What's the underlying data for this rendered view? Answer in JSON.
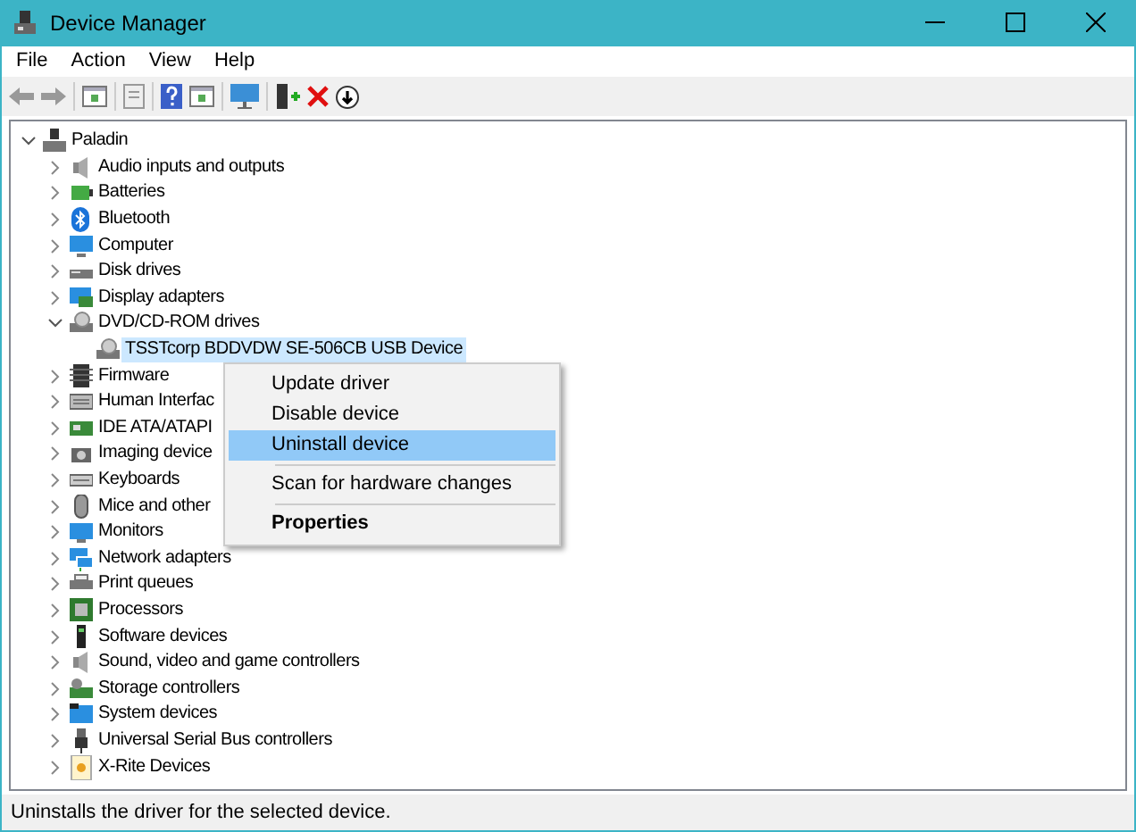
{
  "window": {
    "title": "Device Manager"
  },
  "menu_bar": [
    "File",
    "Action",
    "View",
    "Help"
  ],
  "tree": [
    {
      "label": "Paladin",
      "expanded": true,
      "selected": false,
      "children": [
        {
          "label": "Audio inputs and outputs",
          "expanded": false,
          "selected": false
        },
        {
          "label": "Batteries",
          "expanded": false,
          "selected": false
        },
        {
          "label": "Bluetooth",
          "expanded": false,
          "selected": false
        },
        {
          "label": "Computer",
          "expanded": false,
          "selected": false
        },
        {
          "label": "Disk drives",
          "expanded": false,
          "selected": false
        },
        {
          "label": "Display adapters",
          "expanded": false,
          "selected": false
        },
        {
          "label": "DVD/CD-ROM drives",
          "expanded": true,
          "selected": false,
          "children": [
            {
              "label": "TSSTcorp BDDVDW SE-506CB USB Device",
              "selected": true
            }
          ]
        },
        {
          "label": "Firmware",
          "expanded": false,
          "selected": false
        },
        {
          "label": "Human Interfac",
          "expanded": false,
          "selected": false
        },
        {
          "label": "IDE ATA/ATAPI",
          "expanded": false,
          "selected": false
        },
        {
          "label": "Imaging device",
          "expanded": false,
          "selected": false
        },
        {
          "label": "Keyboards",
          "expanded": false,
          "selected": false
        },
        {
          "label": "Mice and other",
          "expanded": false,
          "selected": false
        },
        {
          "label": "Monitors",
          "expanded": false,
          "selected": false
        },
        {
          "label": "Network adapters",
          "expanded": false,
          "selected": false
        },
        {
          "label": "Print queues",
          "expanded": false,
          "selected": false
        },
        {
          "label": "Processors",
          "expanded": false,
          "selected": false
        },
        {
          "label": "Software devices",
          "expanded": false,
          "selected": false
        },
        {
          "label": "Sound, video and game controllers",
          "expanded": false,
          "selected": false
        },
        {
          "label": "Storage controllers",
          "expanded": false,
          "selected": false
        },
        {
          "label": "System devices",
          "expanded": false,
          "selected": false
        },
        {
          "label": "Universal Serial Bus controllers",
          "expanded": false,
          "selected": false
        },
        {
          "label": "X-Rite Devices",
          "expanded": false,
          "selected": false
        }
      ]
    }
  ],
  "context_menu": [
    {
      "kind": "item",
      "label": "Update driver",
      "selected": false,
      "default": false
    },
    {
      "kind": "item",
      "label": "Disable device",
      "selected": false,
      "default": false
    },
    {
      "kind": "item",
      "label": "Uninstall device",
      "selected": true,
      "default": false
    },
    {
      "kind": "separator"
    },
    {
      "kind": "item",
      "label": "Scan for hardware changes",
      "selected": false,
      "default": false
    },
    {
      "kind": "separator"
    },
    {
      "kind": "item",
      "label": "Properties",
      "selected": false,
      "default": true
    }
  ],
  "status_bar": "Uninstalls the driver for the selected device."
}
